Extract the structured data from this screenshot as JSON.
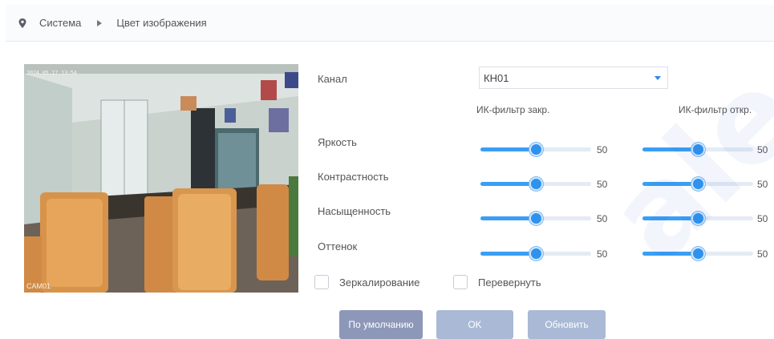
{
  "breadcrumb": {
    "root": "Система",
    "current": "Цвет изображения"
  },
  "preview": {
    "osd_time": "2024.05.17 13:54",
    "osd_camera": "CAM01"
  },
  "channel": {
    "label": "Канал",
    "value": "КН01"
  },
  "columns": {
    "ir_closed": "ИК-фильтр закр.",
    "ir_open": "ИК-фильтр откр."
  },
  "settings": [
    {
      "label": "Яркость",
      "ir_closed": 50,
      "ir_open": 50
    },
    {
      "label": "Контрастность",
      "ir_closed": 50,
      "ir_open": 50
    },
    {
      "label": "Насыщенность",
      "ir_closed": 50,
      "ir_open": 50
    },
    {
      "label": "Оттенок",
      "ir_closed": 50,
      "ir_open": 50
    }
  ],
  "slider_max": 100,
  "options": {
    "mirror": {
      "label": "Зеркалирование",
      "checked": false
    },
    "flip": {
      "label": "Перевернуть",
      "checked": false
    }
  },
  "buttons": {
    "default": "По умолчанию",
    "ok": "OK",
    "refresh": "Обновить"
  },
  "colors": {
    "accent": "#2e92ee",
    "button_primary": "#8d97b8",
    "button_secondary": "#a9b9d6"
  }
}
